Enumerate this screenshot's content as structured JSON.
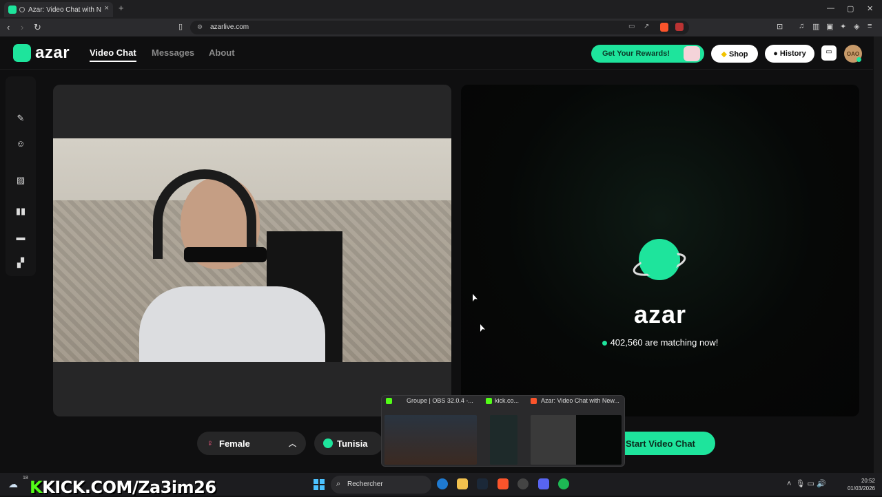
{
  "browser": {
    "tab_title": "Azar: Video Chat with New Pe",
    "new_tab": "+",
    "close_tab": "×",
    "url": "azarlive.com",
    "window_min": "—",
    "window_max": "▢",
    "window_close": "✕"
  },
  "header": {
    "brand": "azar",
    "nav": {
      "video_chat": "Video Chat",
      "messages": "Messages",
      "about": "About"
    },
    "rewards": "Get Your Rewards!",
    "shop": "Shop",
    "history": "History",
    "avatar_text": "OAO"
  },
  "main": {
    "brand_big": "azar",
    "matching_text": "402,560 are matching now!",
    "gender": "Female",
    "country": "Tunisia",
    "start": "Start Video Chat"
  },
  "taskbar_preview": {
    "items": [
      "Groupe | OBS 32.0.4 -...",
      "kick.co...",
      "Azar: Video Chat with New..."
    ]
  },
  "taskbar": {
    "weather_temp": "18",
    "overlay_prefix": "K",
    "overlay_text": "KICK.COM/Za3im26",
    "search_placeholder": "Rechercher",
    "time": "20:52",
    "date": "01/03/2026"
  },
  "colors": {
    "accent": "#1ee49c",
    "female": "#ff5b86",
    "kick": "#53fc18"
  }
}
